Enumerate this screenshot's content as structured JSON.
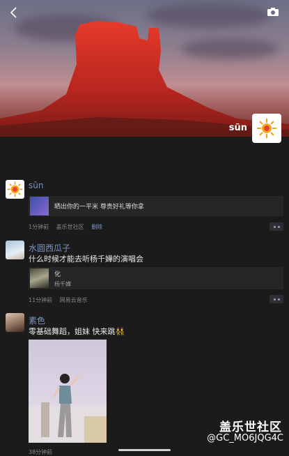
{
  "cover": {
    "user_name": "sūn"
  },
  "posts": [
    {
      "name": "sūn",
      "share_title": "晒出你的一平米 尊贵好礼等你拿",
      "meta": {
        "time": "1分钟前",
        "source": "盖乐世社区",
        "action": "删除"
      }
    },
    {
      "name": "水圆西瓜子",
      "text": "什么时候才能去听杨千嬅的演唱会",
      "share_title": "化",
      "share_sub": "杨千嬅",
      "meta": {
        "time": "11分钟前",
        "source": "网易云音乐"
      }
    },
    {
      "name": "素色",
      "text": "零基础舞蹈，姐妹 快来跳👯",
      "meta": {
        "time": "38分钟前"
      }
    }
  ],
  "watermark": {
    "brand": "盖乐世社区",
    "handle": "@GC_MO6JQG4C"
  },
  "icons": [
    "back-icon",
    "camera-icon",
    "sun-avatar-icon",
    "more-dots-icon"
  ],
  "colors": {
    "background": "#1b1b1b",
    "name_link": "#7d93be",
    "card": "#262626"
  }
}
